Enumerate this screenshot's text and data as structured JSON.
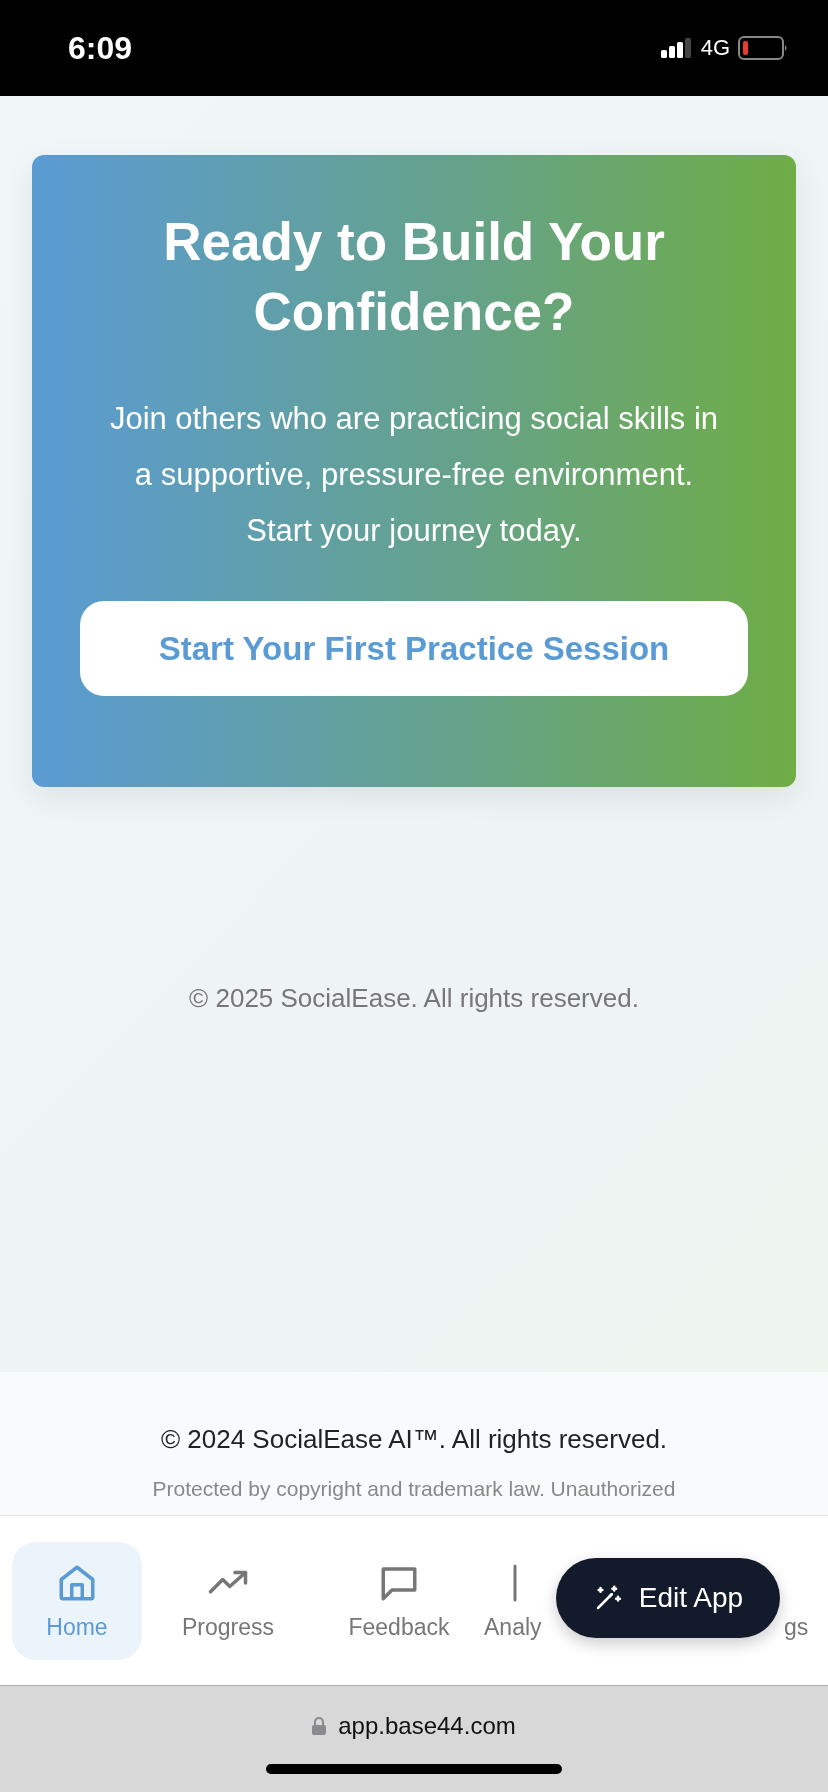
{
  "status_bar": {
    "time": "6:09",
    "network": "4G"
  },
  "cta": {
    "title": "Ready to Build Your Confidence?",
    "text": "Join others who are practicing social skills in a supportive, pressure-free environment. Start your journey today.",
    "button": "Start Your First Practice Session"
  },
  "copyright": "© 2025 SocialEase. All rights reserved.",
  "footer": {
    "copyright": "© 2024 SocialEase AI™. All rights reserved.",
    "notice": "Protected by copyright and trademark law. Unauthorized"
  },
  "nav": [
    {
      "label": "Home",
      "kind": "home",
      "selected": true
    },
    {
      "label": "Progress",
      "kind": "progress",
      "selected": false
    },
    {
      "label": "Feedback",
      "kind": "feedback",
      "selected": false
    },
    {
      "label": "Analy",
      "kind": "analytics",
      "selected": false
    },
    {
      "label": "gs",
      "kind": "settings",
      "selected": false
    }
  ],
  "edit_button": "Edit App",
  "browser": {
    "url": "app.base44.com"
  }
}
